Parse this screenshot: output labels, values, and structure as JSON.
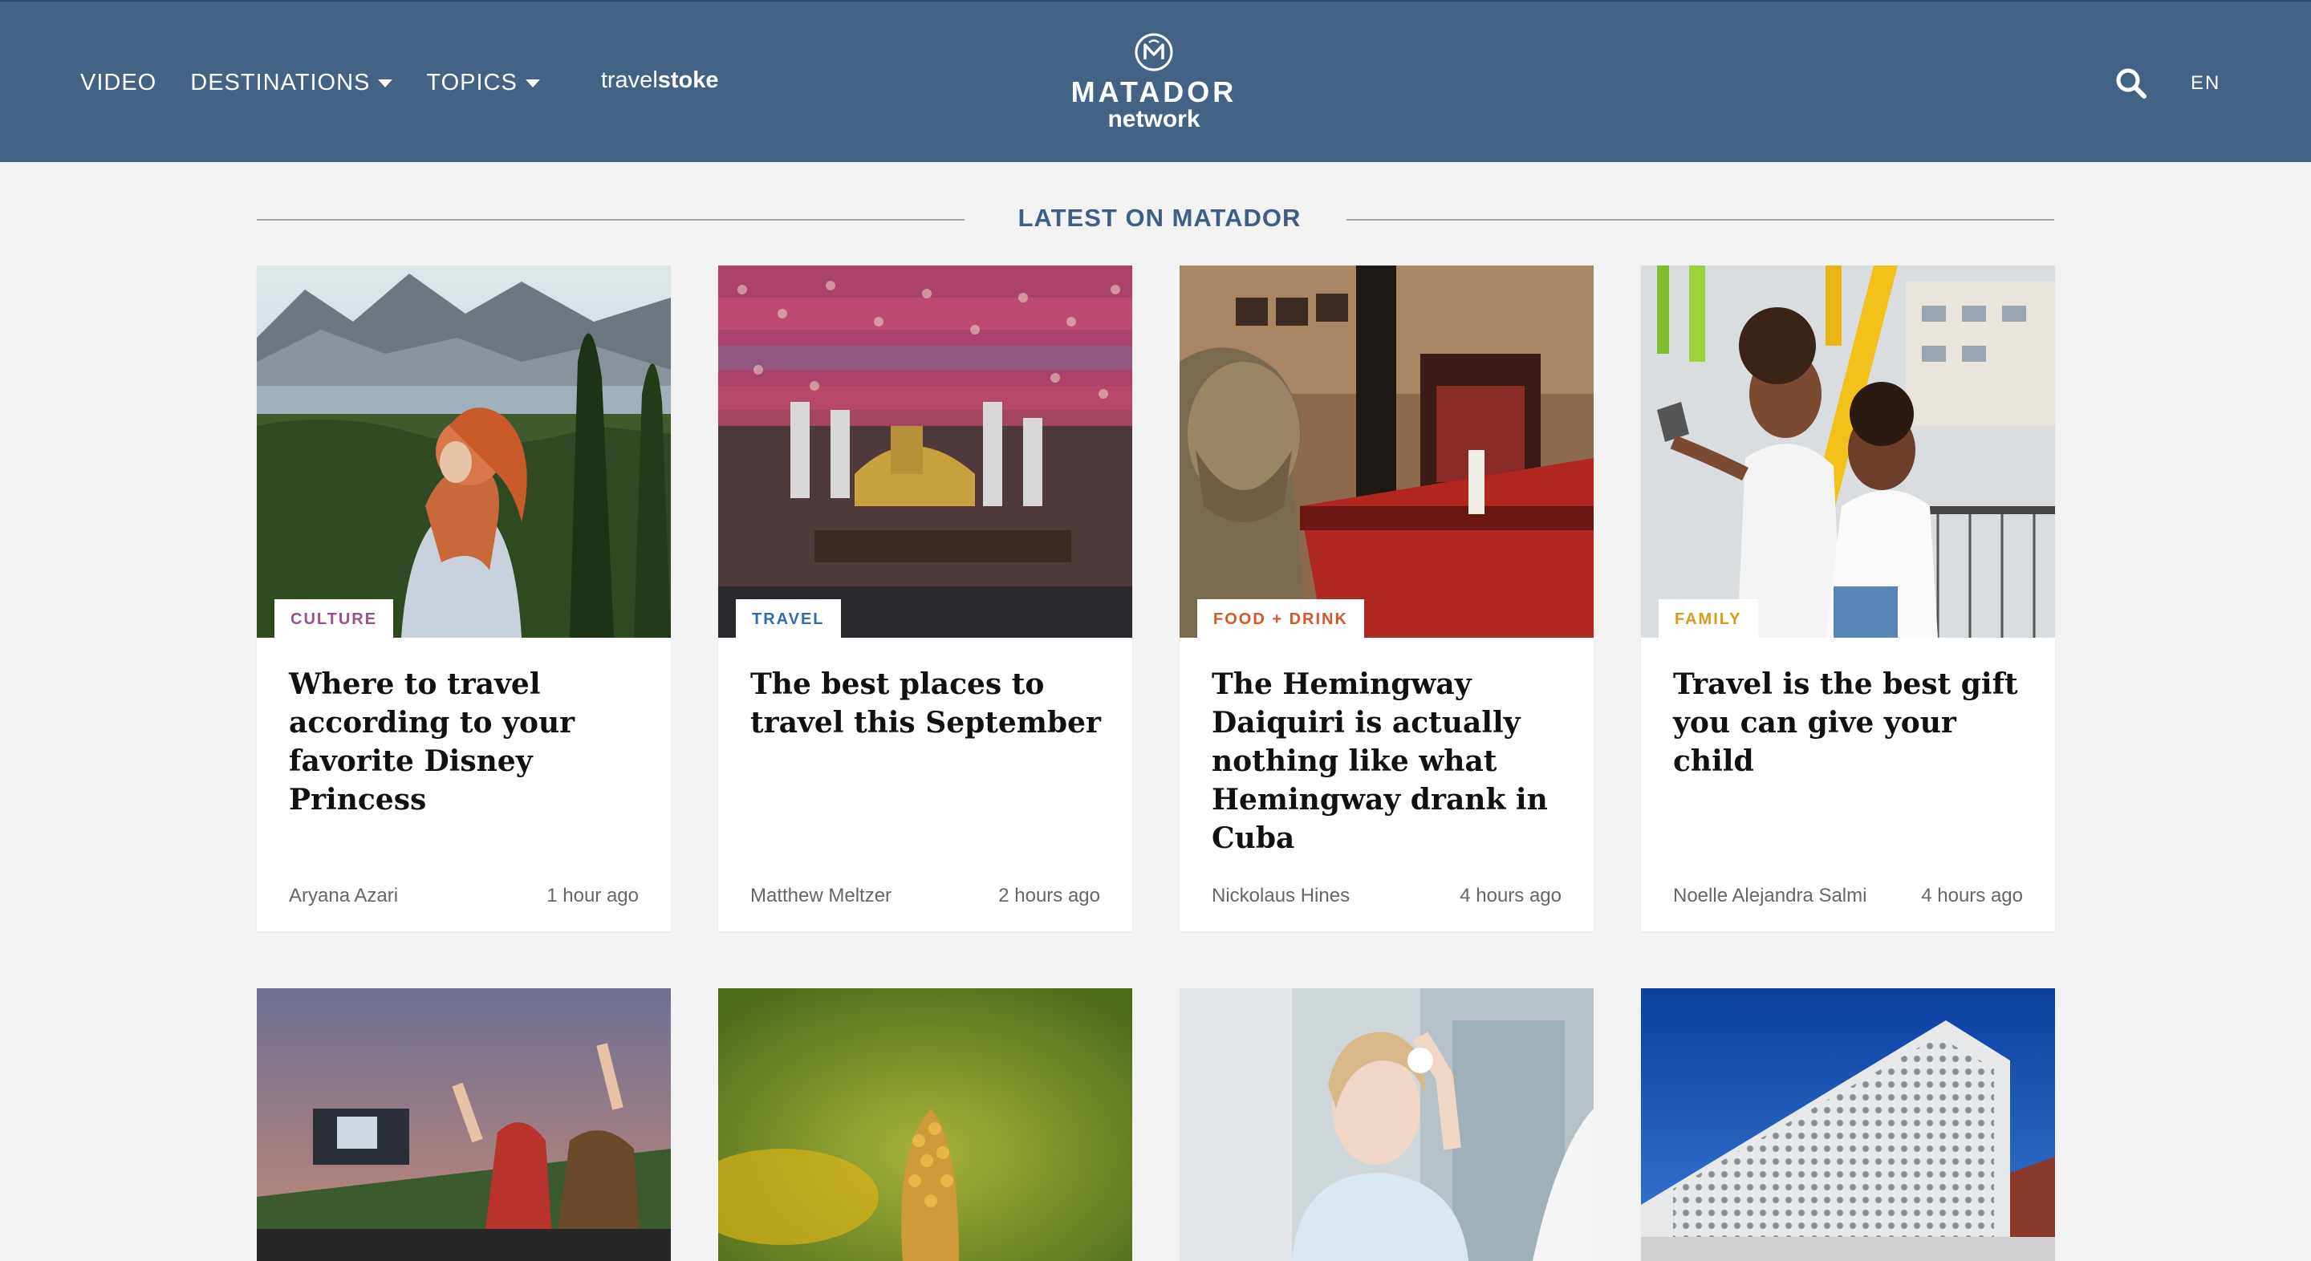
{
  "header": {
    "nav": [
      {
        "label": "VIDEO"
      },
      {
        "label": "DESTINATIONS"
      },
      {
        "label": "TOPICS"
      }
    ],
    "brand_link": {
      "part1": "travel",
      "part2": "stoke"
    },
    "logo": {
      "title": "MATADOR",
      "subtitle": "network"
    },
    "language": "EN"
  },
  "section_title": "LATEST ON MATADOR",
  "cards": [
    {
      "tag": "CULTURE",
      "tag_color": "#9b4f8a",
      "title": "Where to travel according to your favorite Disney Princess",
      "author": "Aryana Azari",
      "time": "1 hour ago"
    },
    {
      "tag": "TRAVEL",
      "tag_color": "#2f6bb3",
      "title": "The best places to travel this September",
      "author": "Matthew Meltzer",
      "time": "2 hours ago"
    },
    {
      "tag": "FOOD + DRINK",
      "tag_color": "#d4572a",
      "title": "The Hemingway Daiquiri is actually nothing like what Hemingway drank in Cuba",
      "author": "Nickolaus Hines",
      "time": "4 hours ago"
    },
    {
      "tag": "FAMILY",
      "tag_color": "#d79a1c",
      "title": "Travel is the best gift you can give your child",
      "author": "Noelle Alejandra Salmi",
      "time": "4 hours ago"
    }
  ],
  "colors": {
    "header_bg": "#426386",
    "page_bg": "#f3f3f3",
    "accent": "#3e5f83"
  }
}
